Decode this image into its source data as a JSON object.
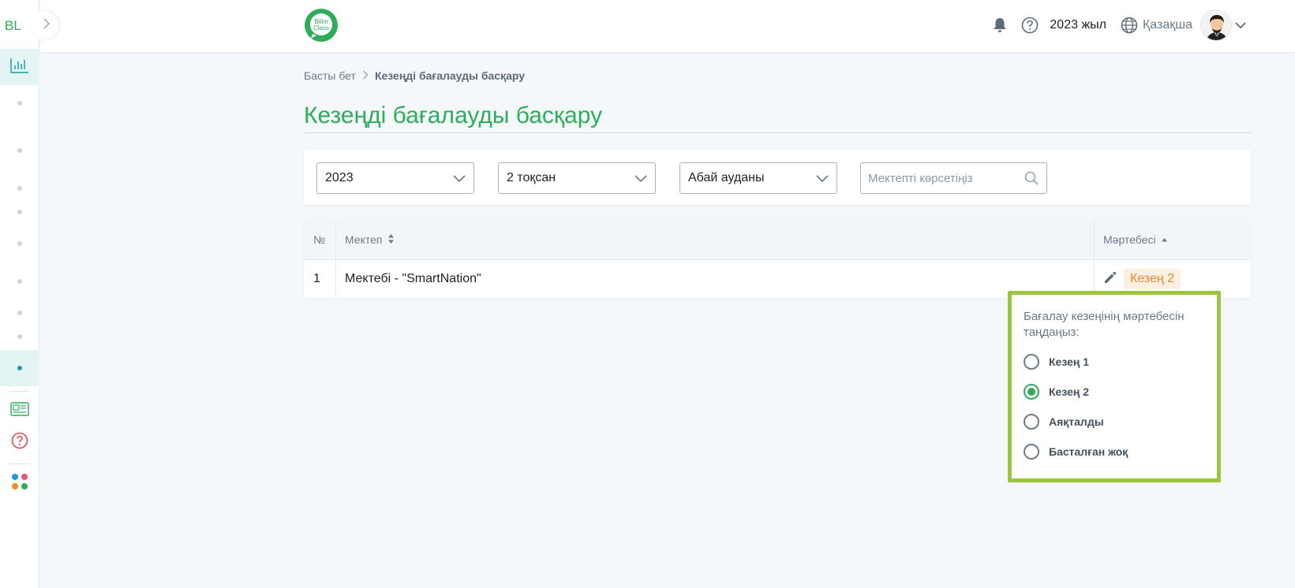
{
  "sidebar": {
    "logo_text": "BL",
    "icons": [
      "expand-chevron-icon",
      "chart-icon",
      "news-icon",
      "help-icon",
      "apps-icon"
    ]
  },
  "header": {
    "brand_text": "Bilim Class",
    "year": "2023 жыл",
    "language": "Қазақша"
  },
  "breadcrumb": {
    "home": "Басты бет",
    "current": "Кезеңді бағалауды басқару"
  },
  "page_title": "Кезеңді бағалауды басқару",
  "filters": {
    "year": "2023",
    "quarter": "2 тоқсан",
    "district": "Абай ауданы",
    "search_placeholder": "Мектепті көрсетіңіз"
  },
  "table": {
    "columns": [
      "№",
      "Мектеп",
      "Мәртебесі"
    ],
    "rows": [
      {
        "num": "1",
        "school": "Мектебі - \"SmartNation\"",
        "status": "Кезең 2"
      }
    ]
  },
  "popover": {
    "title": "Бағалау кезеңінің мәртебесін таңдаңыз:",
    "options": [
      "Кезең 1",
      "Кезең 2",
      "Аяқталды",
      "Басталған жоқ"
    ],
    "selected": "Кезең 2"
  },
  "colors": {
    "accent_green": "#2fac5a",
    "teal": "#1e9ca0",
    "badge_orange": "#e8862b",
    "popover_border": "#9bc53d"
  }
}
